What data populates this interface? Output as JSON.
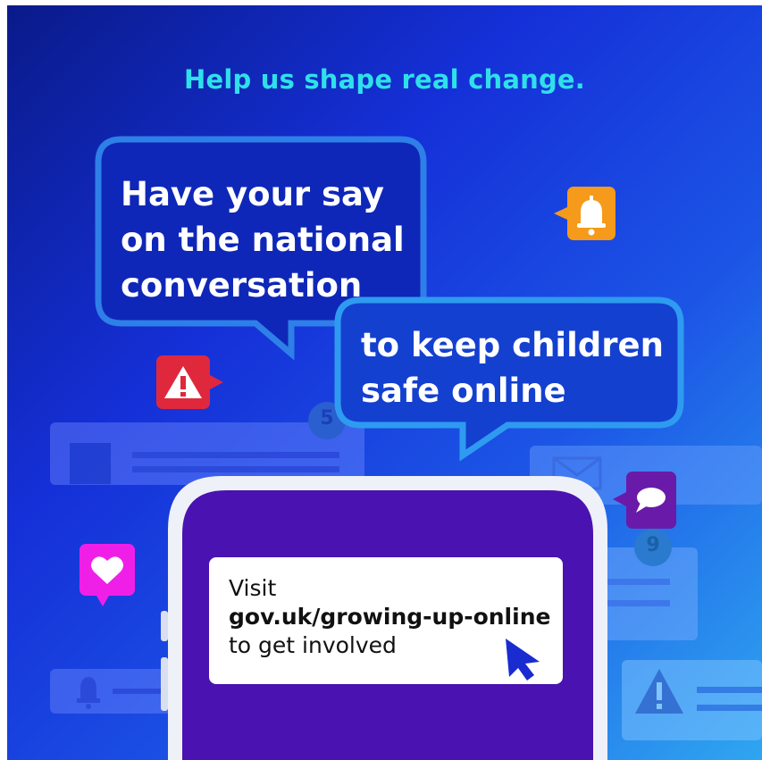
{
  "tagline": "Help us shape real change.",
  "bubble_one": {
    "line1": "Have your say",
    "line2": "on the national",
    "line3": "conversation"
  },
  "bubble_two": {
    "line1": "to keep children",
    "line2": "safe online"
  },
  "card": {
    "line1": "Visit",
    "line2": "gov.uk/growing-up-online",
    "line3": "to get involved"
  },
  "badges": {
    "top_count": "5",
    "right_count": "9"
  },
  "colors": {
    "tagline": "#2fe0ea",
    "bubble_outline": "#2e7fe8",
    "alert_red": "#e0283c",
    "bell_orange": "#f59a1a",
    "heart_magenta": "#f01fe8",
    "chat_purple": "#6a1aa8",
    "phone_screen": "#4a12b0"
  },
  "icons": [
    "bell-icon",
    "warning-icon",
    "heart-icon",
    "chat-icon",
    "mail-icon",
    "cursor-icon"
  ]
}
